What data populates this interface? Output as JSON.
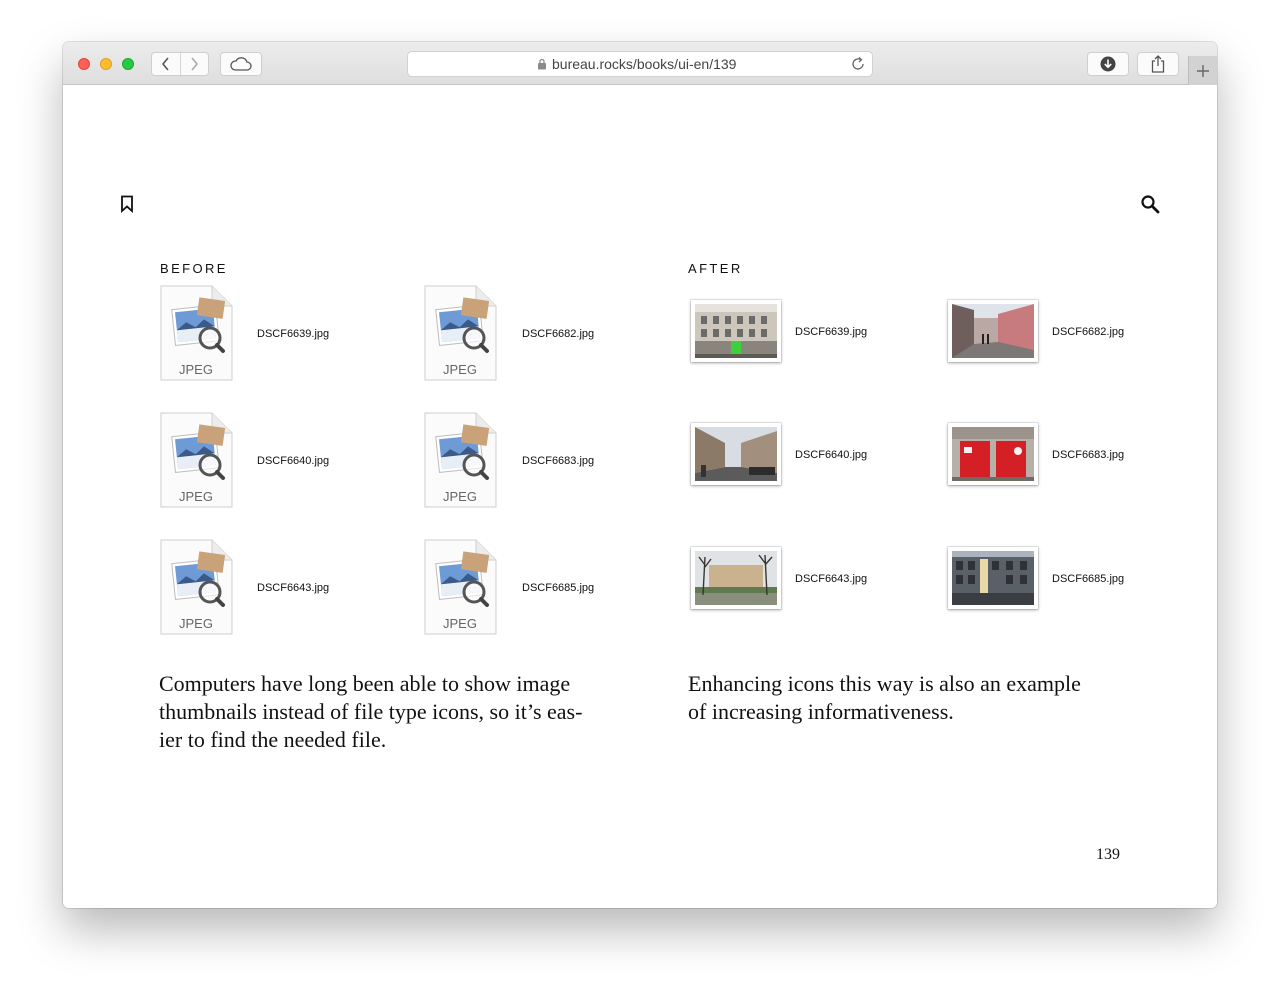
{
  "browser": {
    "url": "bureau.rocks/books/ui-en/139"
  },
  "before": {
    "title": "BEFORE",
    "type_label": "JPEG",
    "files": [
      "DSCF6639.jpg",
      "DSCF6682.jpg",
      "DSCF6640.jpg",
      "DSCF6683.jpg",
      "DSCF6643.jpg",
      "DSCF6685.jpg"
    ]
  },
  "after": {
    "title": "AFTER",
    "files": [
      "DSCF6639.jpg",
      "DSCF6682.jpg",
      "DSCF6640.jpg",
      "DSCF6683.jpg",
      "DSCF6643.jpg",
      "DSCF6685.jpg"
    ]
  },
  "text": {
    "before_lines": [
      "Computers have long been able to show image",
      "thumbnails instead of file type icons, so it’s eas-",
      "ier to find the needed file."
    ],
    "after_lines": [
      "Enhancing icons this way is also an example",
      "of increasing informativeness."
    ]
  },
  "page": {
    "number": "139"
  },
  "icons": {
    "bookmark": "bookmark-icon",
    "search": "search-icon",
    "back": "chevron-left-icon",
    "forward": "chevron-right-icon",
    "cloud": "cloud-icon",
    "lock": "lock-icon",
    "reload": "reload-icon",
    "download": "download-icon",
    "share": "share-icon",
    "new_tab": "plus-icon"
  }
}
